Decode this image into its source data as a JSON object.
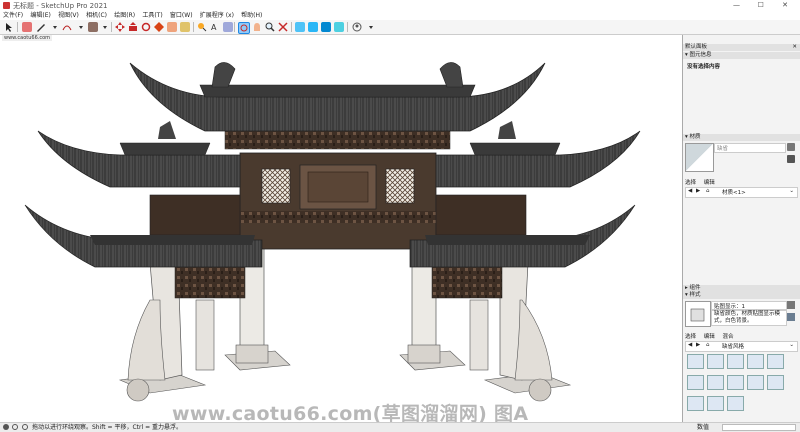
{
  "window": {
    "title": "无标题 - SketchUp Pro 2021",
    "controls": [
      "—",
      "☐",
      "✕"
    ]
  },
  "menu": [
    "文件(F)",
    "编辑(E)",
    "视图(V)",
    "相机(C)",
    "绘图(R)",
    "工具(T)",
    "窗口(W)",
    "扩展程序 (x)",
    "帮助(H)"
  ],
  "viewport": {
    "tagline": "www.caotu66.com",
    "watermark": "www.caotu66.com(草图溜溜网) 图A"
  },
  "tray": {
    "title": "默认面板",
    "entity_info": {
      "header": "图元信息",
      "message": "没有选择内容"
    },
    "materials": {
      "header": "材质",
      "name": "缺省",
      "tabs": [
        "选择",
        "编辑"
      ],
      "dropdown": "材质<1>"
    },
    "components": {
      "header": "组件"
    },
    "styles": {
      "header": "样式",
      "name": "贴图显示：1",
      "desc": "缺省颜色，材质贴图显示模式，白色背景。",
      "tabs": [
        "选择",
        "编辑",
        "混合"
      ],
      "dropdown": "缺省风格"
    }
  },
  "status": {
    "hint": "拖动以进行环绕观察。Shift = 平移，Ctrl = 重力悬浮。",
    "measure_label": "数值"
  },
  "colors": {
    "wood": "#4a3a2e",
    "roof": "#3c3c3c",
    "stone": "#e4e1dc",
    "accent": "#c62828"
  }
}
